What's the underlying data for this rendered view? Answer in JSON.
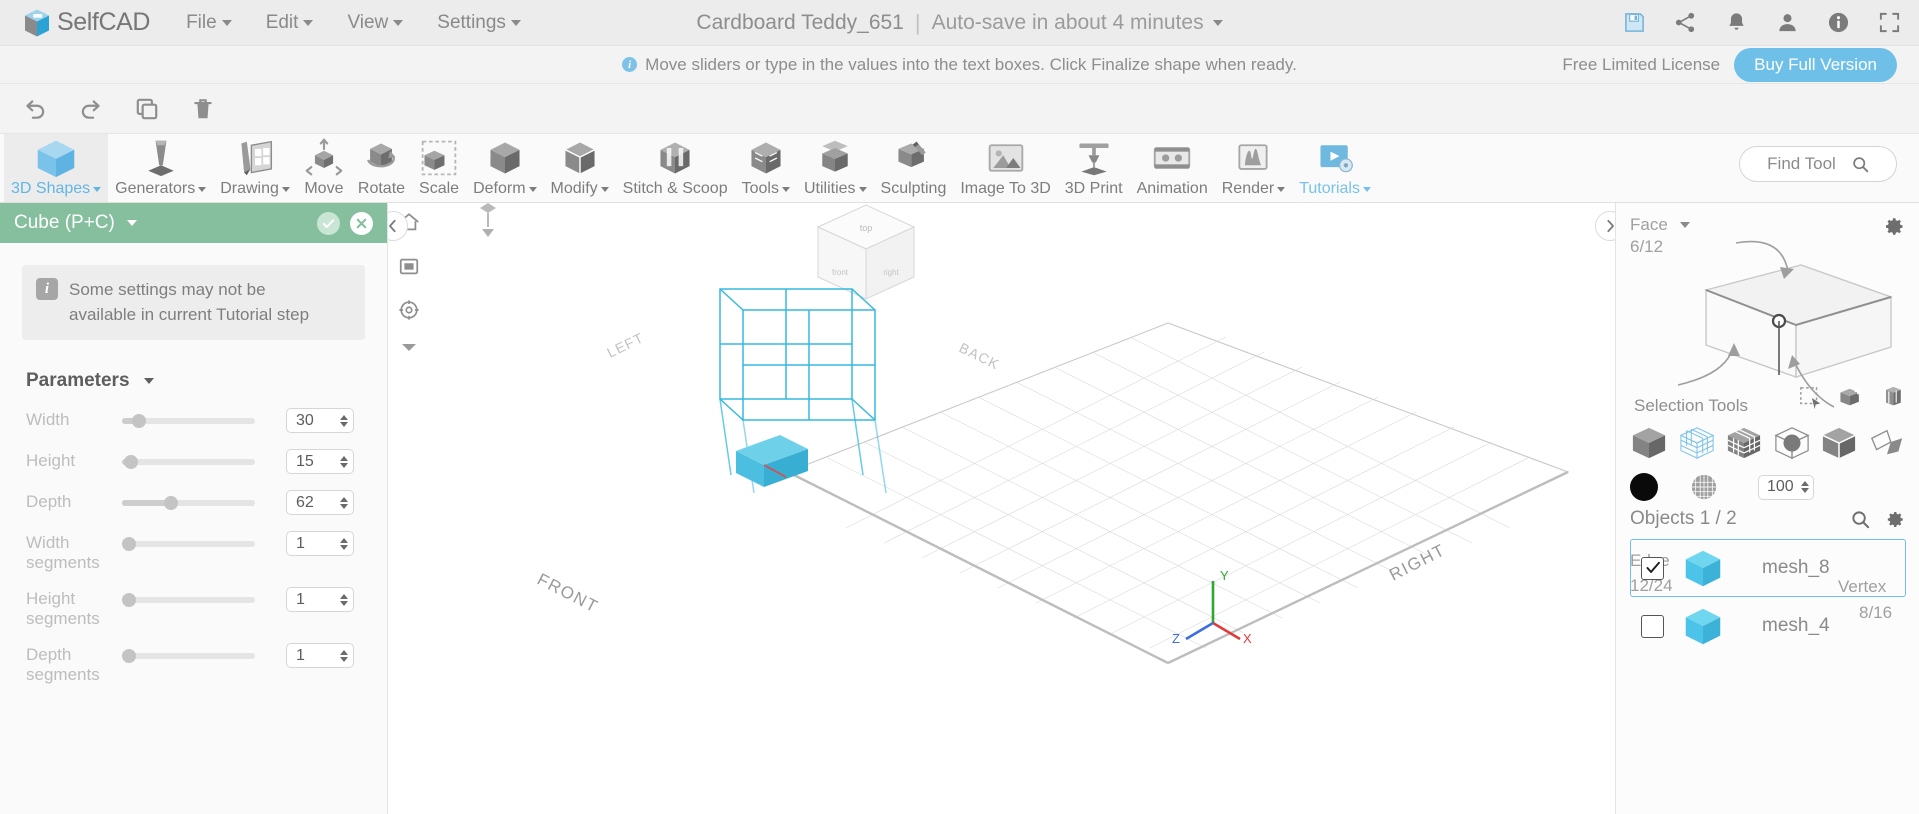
{
  "menubar": {
    "brand": "SelfCAD",
    "items": [
      {
        "label": "File"
      },
      {
        "label": "Edit"
      },
      {
        "label": "View"
      },
      {
        "label": "Settings"
      }
    ],
    "project_title": "Cardboard Teddy_651",
    "separator": "|",
    "autosave": "Auto-save in about 4 minutes",
    "icons": [
      {
        "name": "save-icon"
      },
      {
        "name": "share-icon"
      },
      {
        "name": "notifications-bell-icon"
      },
      {
        "name": "user-account-icon"
      },
      {
        "name": "info-icon"
      },
      {
        "name": "fullscreen-icon"
      }
    ]
  },
  "notification": {
    "info_glyph": "i",
    "message": "Move sliders or type in the values into the text boxes. Click Finalize shape when ready.",
    "license_label": "Free Limited License",
    "buy_label": "Buy Full Version"
  },
  "editrow": {
    "buttons": [
      {
        "name": "undo-button"
      },
      {
        "name": "redo-button"
      },
      {
        "name": "copy-button"
      },
      {
        "name": "delete-button"
      }
    ]
  },
  "toolbar": {
    "tools": [
      {
        "label": "3D Shapes",
        "icon": "cube-icon",
        "caret": true,
        "active": true
      },
      {
        "label": "Generators",
        "icon": "extrude-cone-icon",
        "caret": true
      },
      {
        "label": "Drawing",
        "icon": "pencil-sketch-icon",
        "caret": true
      },
      {
        "label": "Move",
        "icon": "move-arrows-icon",
        "caret": false
      },
      {
        "label": "Rotate",
        "icon": "rotate-cube-icon",
        "caret": false
      },
      {
        "label": "Scale",
        "icon": "scale-cube-icon",
        "caret": false
      },
      {
        "label": "Deform",
        "icon": "deform-cube-icon",
        "caret": true
      },
      {
        "label": "Modify",
        "icon": "modify-cube-icon",
        "caret": true
      },
      {
        "label": "Stitch & Scoop",
        "icon": "stitch-scoop-icon",
        "caret": false
      },
      {
        "label": "Tools",
        "icon": "tools-cube-icon",
        "caret": true
      },
      {
        "label": "Utilities",
        "icon": "utilities-stack-icon",
        "caret": true
      },
      {
        "label": "Sculpting",
        "icon": "sculpting-brush-icon",
        "caret": false
      },
      {
        "label": "Image To 3D",
        "icon": "image-to-3d-icon",
        "caret": false
      },
      {
        "label": "3D Print",
        "icon": "3d-print-icon",
        "caret": false
      },
      {
        "label": "Animation",
        "icon": "animation-film-icon",
        "caret": false
      },
      {
        "label": "Render",
        "icon": "render-icon",
        "caret": true
      },
      {
        "label": "Tutorials",
        "icon": "tutorials-play-icon",
        "caret": true,
        "link": true
      }
    ],
    "find_tool_label": "Find Tool",
    "find_tool_icon": "search-icon"
  },
  "left_panel": {
    "header_title": "Cube (P+C)",
    "confirm_icon": "checkmark-icon",
    "cancel_icon": "close-x-icon",
    "notice_badge": "i",
    "notice_line1": "Some settings may not be",
    "notice_line2": "available in current Tutorial step",
    "section_title": "Parameters",
    "parameters": [
      {
        "label": "Width",
        "value": "30",
        "fill_pct": 13,
        "two_line": false
      },
      {
        "label": "Height",
        "value": "15",
        "fill_pct": 4,
        "two_line": false
      },
      {
        "label": "Depth",
        "value": "62",
        "fill_pct": 38,
        "two_line": false
      },
      {
        "label": "Width segments",
        "label_l1": "Width",
        "label_l2": "segments",
        "value": "1",
        "fill_pct": 0,
        "two_line": true
      },
      {
        "label": "Height segments",
        "label_l1": "Height",
        "label_l2": "segments",
        "value": "1",
        "fill_pct": 0,
        "two_line": true
      },
      {
        "label": "Depth segments",
        "label_l1": "Depth",
        "label_l2": "segments",
        "value": "1",
        "fill_pct": 0,
        "two_line": true
      }
    ]
  },
  "viewport": {
    "left_tools": [
      {
        "name": "home-view-icon"
      },
      {
        "name": "screenshot-icon"
      },
      {
        "name": "orbit-target-icon"
      }
    ],
    "nav_cube_label": "top",
    "grid_labels": [
      "LEFT",
      "BACK",
      "FRONT",
      "RIGHT"
    ],
    "axis_gizmo": {
      "x": "X",
      "y": "Y",
      "z": "Z"
    },
    "collapse_left_icon": "chevron-left-icon",
    "collapse_right_icon": "chevron-right-icon"
  },
  "right_panel": {
    "selection_mode": "Face",
    "face_count": "6/12",
    "edge_label": "Edge",
    "edge_count": "12/24",
    "vertex_label": "Vertex",
    "vertex_count": "8/16",
    "settings_icon": "gear-icon",
    "selection_tools_label": "Selection Tools",
    "selection_tools_right": [
      {
        "name": "rect-select-icon"
      },
      {
        "name": "add-object-select-icon"
      },
      {
        "name": "multi-object-select-icon"
      }
    ],
    "selection_modes": [
      {
        "name": "solid-cube-mode-icon",
        "active": false
      },
      {
        "name": "wireframe-cube-mode-icon",
        "active": true
      },
      {
        "name": "subdivided-cube-mode-icon",
        "active": false
      },
      {
        "name": "sphere-in-cube-mode-icon",
        "active": false
      },
      {
        "name": "split-cube-mode-icon",
        "active": false
      },
      {
        "name": "unfold-mode-icon",
        "active": false
      }
    ],
    "color_swatch": "#0a0a0a",
    "texture_icon": "texture-sphere-icon",
    "opacity_value": "100",
    "objects_title": "Objects 1 / 2",
    "objects_search_icon": "search-icon",
    "objects_gear_icon": "gear-icon",
    "objects": [
      {
        "name": "mesh_8",
        "checked": true,
        "selected": true
      },
      {
        "name": "mesh_4",
        "checked": false,
        "selected": false
      }
    ]
  },
  "colors": {
    "accent_blue": "#6fc0e8",
    "panel_green": "#85bf9e",
    "mesh_cyan": "#4cc3e8",
    "axis_x": "#e03b3b",
    "axis_y": "#2fa82f",
    "axis_z": "#3b6fe0"
  }
}
